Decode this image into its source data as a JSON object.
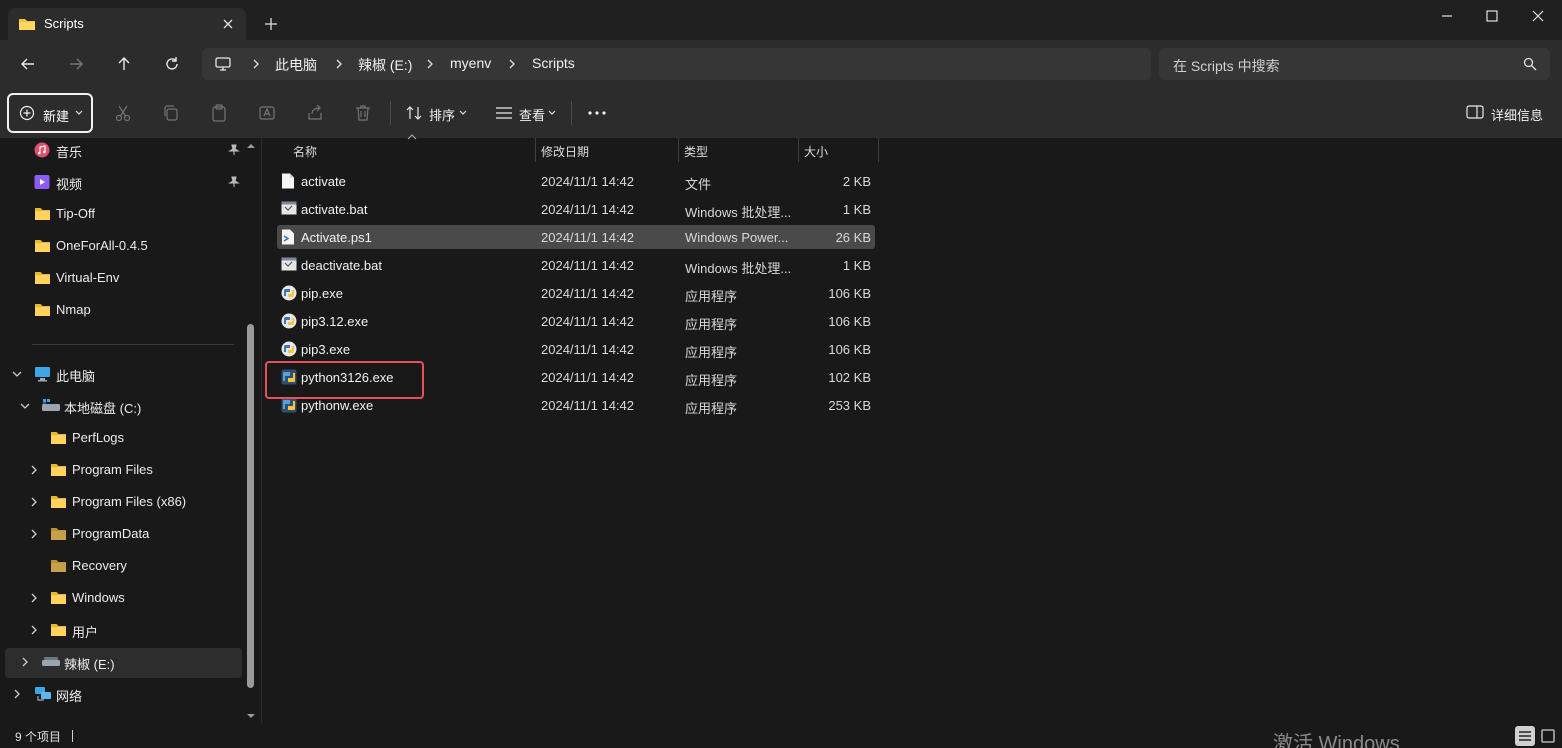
{
  "tab": {
    "title": "Scripts"
  },
  "address": {
    "crumbs": [
      "此电脑",
      "辣椒 (E:)",
      "myenv",
      "Scripts"
    ],
    "search_placeholder": "在 Scripts 中搜索"
  },
  "toolbar": {
    "new_label": "新建",
    "sort_label": "排序",
    "view_label": "查看",
    "details_label": "详细信息"
  },
  "sidebar": {
    "quick_access": [
      {
        "label": "音乐",
        "icon": "music-icon",
        "pinned": true
      },
      {
        "label": "视频",
        "icon": "video-icon",
        "pinned": true
      },
      {
        "label": "Tip-Off",
        "icon": "folder-icon"
      },
      {
        "label": "OneForAll-0.4.5",
        "icon": "folder-icon"
      },
      {
        "label": "Virtual-Env",
        "icon": "folder-icon"
      },
      {
        "label": "Nmap",
        "icon": "folder-icon"
      }
    ],
    "this_pc": "此电脑",
    "drive_c": "本地磁盘 (C:)",
    "c_children": [
      {
        "label": "PerfLogs",
        "expandable": false
      },
      {
        "label": "Program Files",
        "expandable": true
      },
      {
        "label": "Program Files (x86)",
        "expandable": true
      },
      {
        "label": "ProgramData",
        "expandable": true
      },
      {
        "label": "Recovery",
        "expandable": false
      },
      {
        "label": "Windows",
        "expandable": true
      },
      {
        "label": "用户",
        "expandable": true
      }
    ],
    "drive_e": "辣椒 (E:)",
    "network": "网络"
  },
  "columns": {
    "name": "名称",
    "date": "修改日期",
    "type": "类型",
    "size": "大小"
  },
  "files": [
    {
      "name": "activate",
      "date": "2024/11/1 14:42",
      "type": "文件",
      "size": "2 KB",
      "icon": "file-icon"
    },
    {
      "name": "activate.bat",
      "date": "2024/11/1 14:42",
      "type": "Windows 批处理...",
      "size": "1 KB",
      "icon": "batch-file-icon"
    },
    {
      "name": "Activate.ps1",
      "date": "2024/11/1 14:42",
      "type": "Windows Power...",
      "size": "26 KB",
      "icon": "powershell-file-icon",
      "selected": true
    },
    {
      "name": "deactivate.bat",
      "date": "2024/11/1 14:42",
      "type": "Windows 批处理...",
      "size": "1 KB",
      "icon": "batch-file-icon"
    },
    {
      "name": "pip.exe",
      "date": "2024/11/1 14:42",
      "type": "应用程序",
      "size": "106 KB",
      "icon": "python-exe-icon"
    },
    {
      "name": "pip3.12.exe",
      "date": "2024/11/1 14:42",
      "type": "应用程序",
      "size": "106 KB",
      "icon": "python-exe-icon"
    },
    {
      "name": "pip3.exe",
      "date": "2024/11/1 14:42",
      "type": "应用程序",
      "size": "106 KB",
      "icon": "python-exe-icon"
    },
    {
      "name": "python3126.exe",
      "date": "2024/11/1 14:42",
      "type": "应用程序",
      "size": "102 KB",
      "icon": "python-icon"
    },
    {
      "name": "pythonw.exe",
      "date": "2024/11/1 14:42",
      "type": "应用程序",
      "size": "253 KB",
      "icon": "python-icon"
    }
  ],
  "status": {
    "count": "9 个项目"
  },
  "watermark": "激活 Windows",
  "colors": {
    "highlight": "#e8505b",
    "folder": "#f5c542",
    "background": "#191919"
  }
}
